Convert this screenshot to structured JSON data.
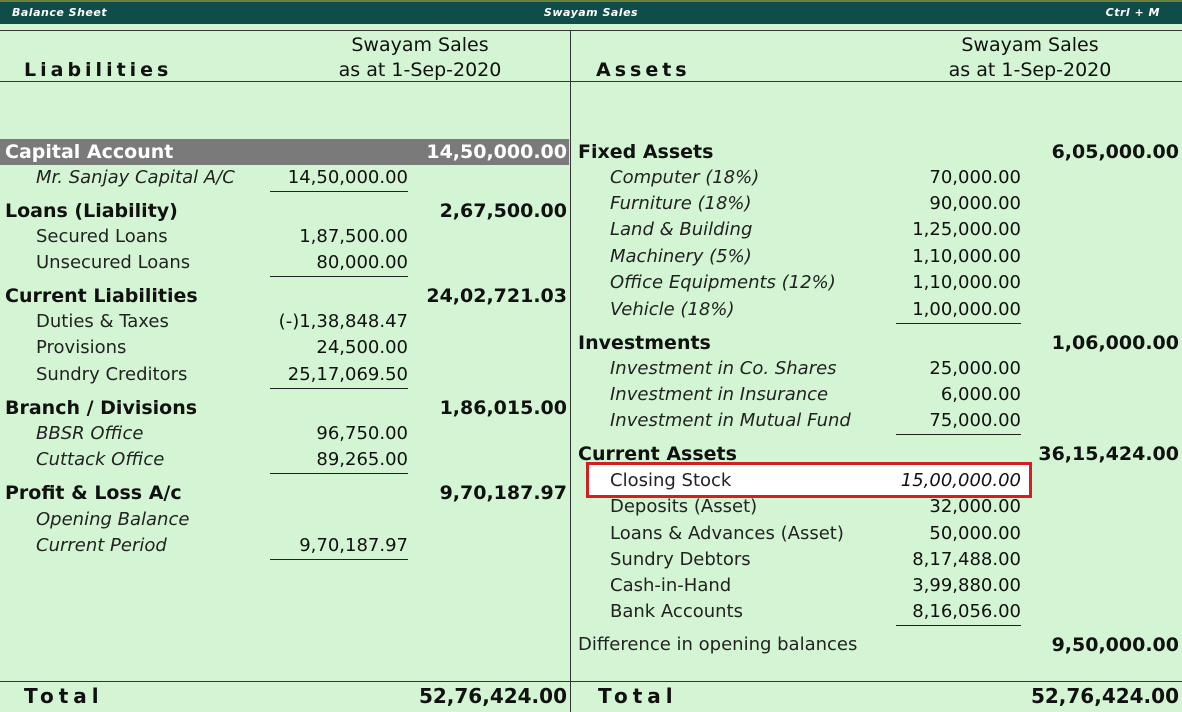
{
  "titlebar": {
    "left": "Balance Sheet",
    "center": "Swayam Sales",
    "right": "Ctrl + M"
  },
  "liabilities": {
    "heading": "Liabilities",
    "company": "Swayam Sales",
    "date": "as at 1-Sep-2020",
    "capital_account": {
      "label": "Capital Account",
      "amount": "14,50,000.00",
      "items": [
        {
          "label": "Mr. Sanjay Capital A/C",
          "amount": "14,50,000.00"
        }
      ]
    },
    "loans": {
      "label": "Loans (Liability)",
      "amount": "2,67,500.00",
      "items": [
        {
          "label": "Secured Loans",
          "amount": "1,87,500.00"
        },
        {
          "label": "Unsecured Loans",
          "amount": "80,000.00"
        }
      ]
    },
    "current_liabilities": {
      "label": "Current Liabilities",
      "amount": "24,02,721.03",
      "items": [
        {
          "label": "Duties & Taxes",
          "amount": "(-)1,38,848.47"
        },
        {
          "label": "Provisions",
          "amount": "24,500.00"
        },
        {
          "label": "Sundry Creditors",
          "amount": "25,17,069.50"
        }
      ]
    },
    "branch": {
      "label": "Branch / Divisions",
      "amount": "1,86,015.00",
      "items": [
        {
          "label": "BBSR Office",
          "amount": "96,750.00"
        },
        {
          "label": "Cuttack Office",
          "amount": "89,265.00"
        }
      ]
    },
    "pl": {
      "label": "Profit & Loss A/c",
      "amount": "9,70,187.97",
      "items": [
        {
          "label": "Opening Balance",
          "amount": ""
        },
        {
          "label": "Current Period",
          "amount": "9,70,187.97"
        }
      ]
    },
    "total_label": "Total",
    "total": "52,76,424.00"
  },
  "assets": {
    "heading": "Assets",
    "company": "Swayam Sales",
    "date": "as at 1-Sep-2020",
    "fixed": {
      "label": "Fixed Assets",
      "amount": "6,05,000.00",
      "items": [
        {
          "label": "Computer (18%)",
          "amount": "70,000.00"
        },
        {
          "label": "Furniture (18%)",
          "amount": "90,000.00"
        },
        {
          "label": "Land & Building",
          "amount": "1,25,000.00"
        },
        {
          "label": "Machinery (5%)",
          "amount": "1,10,000.00"
        },
        {
          "label": "Office Equipments (12%)",
          "amount": "1,10,000.00"
        },
        {
          "label": "Vehicle (18%)",
          "amount": "1,00,000.00"
        }
      ]
    },
    "investments": {
      "label": "Investments",
      "amount": "1,06,000.00",
      "items": [
        {
          "label": "Investment in Co. Shares",
          "amount": "25,000.00"
        },
        {
          "label": "Investment in Insurance",
          "amount": "6,000.00"
        },
        {
          "label": "Investment in Mutual Fund",
          "amount": "75,000.00"
        }
      ]
    },
    "current": {
      "label": "Current Assets",
      "amount": "36,15,424.00",
      "items": [
        {
          "label": "Closing Stock",
          "amount": "15,00,000.00"
        },
        {
          "label": "Deposits (Asset)",
          "amount": "32,000.00"
        },
        {
          "label": "Loans & Advances (Asset)",
          "amount": "50,000.00"
        },
        {
          "label": "Sundry Debtors",
          "amount": "8,17,488.00"
        },
        {
          "label": "Cash-in-Hand",
          "amount": "3,99,880.00"
        },
        {
          "label": "Bank Accounts",
          "amount": "8,16,056.00"
        }
      ]
    },
    "difference": {
      "label": "Difference in opening balances",
      "amount": "9,50,000.00"
    },
    "total_label": "Total",
    "total": "52,76,424.00"
  },
  "colors": {
    "background": "#d4f5d4",
    "titlebar": "#0f4c4a",
    "highlight_border": "#d21f1f",
    "selected_bar": "#7a7a7a"
  }
}
